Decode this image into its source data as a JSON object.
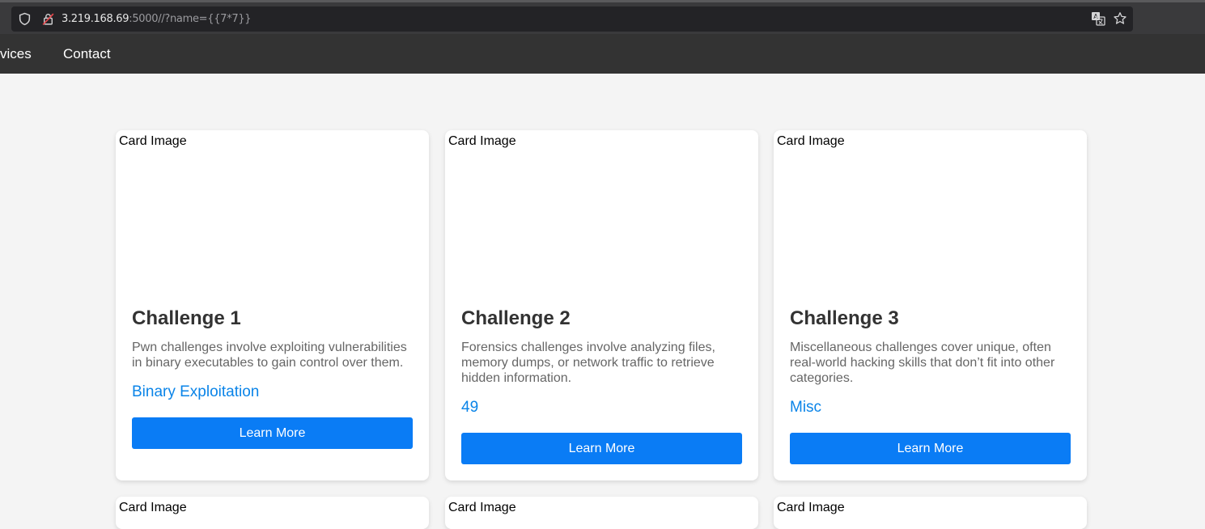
{
  "browser": {
    "url_host": "3.219.168.69",
    "url_rest": ":5000//?name={{7*7}}",
    "icons": [
      "shield-icon",
      "insecure-lock-icon",
      "translate-icon",
      "bookmark-star-icon"
    ]
  },
  "nav": {
    "items": [
      {
        "label": "vices"
      },
      {
        "label": "Contact"
      }
    ]
  },
  "cards": [
    {
      "image_alt": "Card Image",
      "title": "Challenge 1",
      "description": "Pwn challenges involve exploiting vulnerabilities in binary executables to gain control over them.",
      "category": "Binary Exploitation",
      "button": "Learn More"
    },
    {
      "image_alt": "Card Image",
      "title": "Challenge 2",
      "description": "Forensics challenges involve analyzing files, memory dumps, or network traffic to retrieve hidden information.",
      "category": "49",
      "button": "Learn More"
    },
    {
      "image_alt": "Card Image",
      "title": "Challenge 3",
      "description": "Miscellaneous challenges cover unique, often real-world hacking skills that don’t fit into other categories.",
      "category": "Misc",
      "button": "Learn More"
    },
    {
      "image_alt": "Card Image"
    },
    {
      "image_alt": "Card Image"
    },
    {
      "image_alt": "Card Image"
    }
  ],
  "colors": {
    "accent": "#0a7cf5",
    "link": "#0a84e8",
    "nav_bg": "#333333",
    "page_bg": "#f4f4f4"
  }
}
